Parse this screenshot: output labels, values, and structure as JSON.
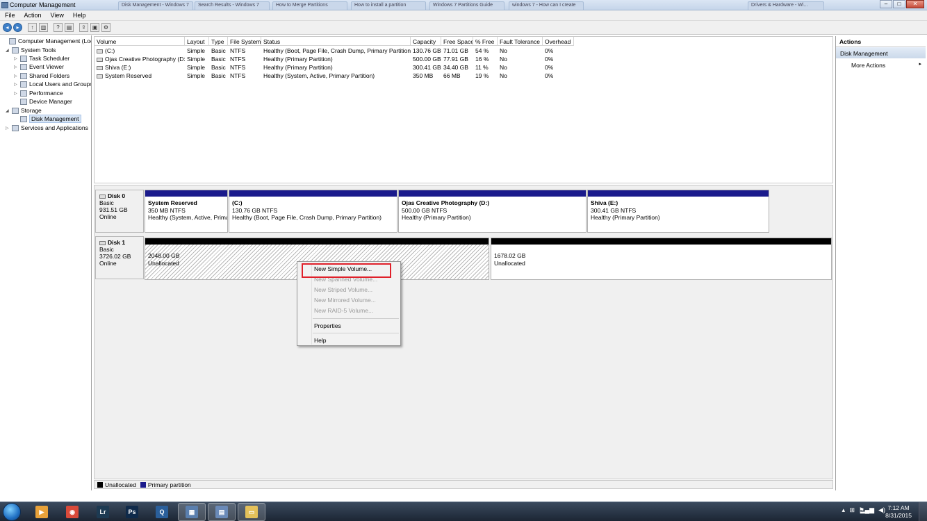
{
  "window": {
    "title": "Computer Management",
    "background_tabs": [
      "Disk Management - Windows 7",
      "Search Results - Windows 7",
      "How to Merge Partitions",
      "How to install a partition",
      "Windows 7 Partitions Guide",
      "windows 7 - How can I create",
      "Drivers & Hardware - Wi..."
    ],
    "minimize": "–",
    "maximize": "□",
    "close": "✕"
  },
  "menu": [
    "File",
    "Action",
    "View",
    "Help"
  ],
  "tree": {
    "items": [
      {
        "label": "Computer Management (Local",
        "level": 0,
        "expander": "",
        "icon": "computer-icon"
      },
      {
        "label": "System Tools",
        "level": 1,
        "expander": "◢",
        "icon": "tools-icon"
      },
      {
        "label": "Task Scheduler",
        "level": 2,
        "expander": "▷",
        "icon": "clock-icon"
      },
      {
        "label": "Event Viewer",
        "level": 2,
        "expander": "▷",
        "icon": "event-viewer-icon"
      },
      {
        "label": "Shared Folders",
        "level": 2,
        "expander": "▷",
        "icon": "shared-folder-icon"
      },
      {
        "label": "Local Users and Groups",
        "level": 2,
        "expander": "▷",
        "icon": "users-icon"
      },
      {
        "label": "Performance",
        "level": 2,
        "expander": "▷",
        "icon": "performance-icon"
      },
      {
        "label": "Device Manager",
        "level": 2,
        "expander": "",
        "icon": "device-manager-icon"
      },
      {
        "label": "Storage",
        "level": 1,
        "expander": "◢",
        "icon": "storage-icon"
      },
      {
        "label": "Disk Management",
        "level": 2,
        "expander": "",
        "icon": "disk-icon",
        "selected": true
      },
      {
        "label": "Services and Applications",
        "level": 1,
        "expander": "▷",
        "icon": "services-icon"
      }
    ],
    "scroll_thumb": "|||",
    "scroll_left": "◂",
    "scroll_right": "▸"
  },
  "volumes": {
    "columns": [
      "Volume",
      "Layout",
      "Type",
      "File System",
      "Status",
      "Capacity",
      "Free Space",
      "% Free",
      "Fault Tolerance",
      "Overhead"
    ],
    "rows": [
      [
        "(C:)",
        "Simple",
        "Basic",
        "NTFS",
        "Healthy (Boot, Page File, Crash Dump, Primary Partition)",
        "130.76 GB",
        "71.01 GB",
        "54 %",
        "No",
        "0%"
      ],
      [
        "Ojas Creative Photography (D:)",
        "Simple",
        "Basic",
        "NTFS",
        "Healthy (Primary Partition)",
        "500.00 GB",
        "77.91 GB",
        "16 %",
        "No",
        "0%"
      ],
      [
        "Shiva (E:)",
        "Simple",
        "Basic",
        "NTFS",
        "Healthy (Primary Partition)",
        "300.41 GB",
        "34.40 GB",
        "11 %",
        "No",
        "0%"
      ],
      [
        "System Reserved",
        "Simple",
        "Basic",
        "NTFS",
        "Healthy (System, Active, Primary Partition)",
        "350 MB",
        "66 MB",
        "19 %",
        "No",
        "0%"
      ]
    ]
  },
  "disks": [
    {
      "name": "Disk 0",
      "type": "Basic",
      "size": "931.51 GB",
      "status": "Online",
      "partitions": [
        {
          "name": "System Reserved",
          "size": "350 MB NTFS",
          "status": "Healthy (System, Active, Primary Partition)"
        },
        {
          "name": "(C:)",
          "size": "130.76 GB NTFS",
          "status": "Healthy (Boot, Page File, Crash Dump, Primary Partition)"
        },
        {
          "name": "Ojas Creative Photography  (D:)",
          "size": "500.00 GB NTFS",
          "status": "Healthy (Primary Partition)"
        },
        {
          "name": "Shiva  (E:)",
          "size": "300.41 GB NTFS",
          "status": "Healthy (Primary Partition)"
        }
      ]
    },
    {
      "name": "Disk 1",
      "type": "Basic",
      "size": "3726.02 GB",
      "status": "Online",
      "partitions": [
        {
          "size": "2048.00 GB",
          "status": "Unallocated"
        },
        {
          "size": "1678.02 GB",
          "status": "Unallocated"
        }
      ]
    }
  ],
  "legend": [
    {
      "label": "Unallocated",
      "color": "#000000"
    },
    {
      "label": "Primary partition",
      "color": "#1a1a8c"
    }
  ],
  "actions": {
    "header": "Actions",
    "section": "Disk Management",
    "more": "More Actions",
    "more_arrow": "▸"
  },
  "context_menu": {
    "items": [
      {
        "label": "New Simple Volume...",
        "enabled": true
      },
      {
        "label": "New Spanned Volume...",
        "enabled": false
      },
      {
        "label": "New Striped Volume...",
        "enabled": false
      },
      {
        "label": "New Mirrored Volume...",
        "enabled": false
      },
      {
        "label": "New RAID-5 Volume...",
        "enabled": false
      },
      {
        "label": "Properties",
        "enabled": true
      },
      {
        "label": "Help",
        "enabled": true
      }
    ]
  },
  "taskbar": {
    "apps": [
      {
        "label": "▶",
        "name": "media-player",
        "color": "#e8a23a"
      },
      {
        "label": "◉",
        "name": "chrome",
        "color": "#d94a3a"
      },
      {
        "label": "Lr",
        "name": "lightroom",
        "color": "#1d3a52"
      },
      {
        "label": "Ps",
        "name": "photoshop",
        "color": "#0f2a4a"
      },
      {
        "label": "Q",
        "name": "app-q",
        "color": "#2a5f9b"
      },
      {
        "label": "▦",
        "name": "computer-management",
        "color": "#5a7fae"
      },
      {
        "label": "▤",
        "name": "remote",
        "color": "#6a8ab8"
      },
      {
        "label": "▭",
        "name": "explorer",
        "color": "#e4c15a"
      }
    ],
    "time": "7:12 AM",
    "date": "8/31/2015"
  },
  "colors": {
    "primary_partition": "#1a1a8c",
    "unallocated": "#000000",
    "highlight_box": "#e0202a"
  }
}
